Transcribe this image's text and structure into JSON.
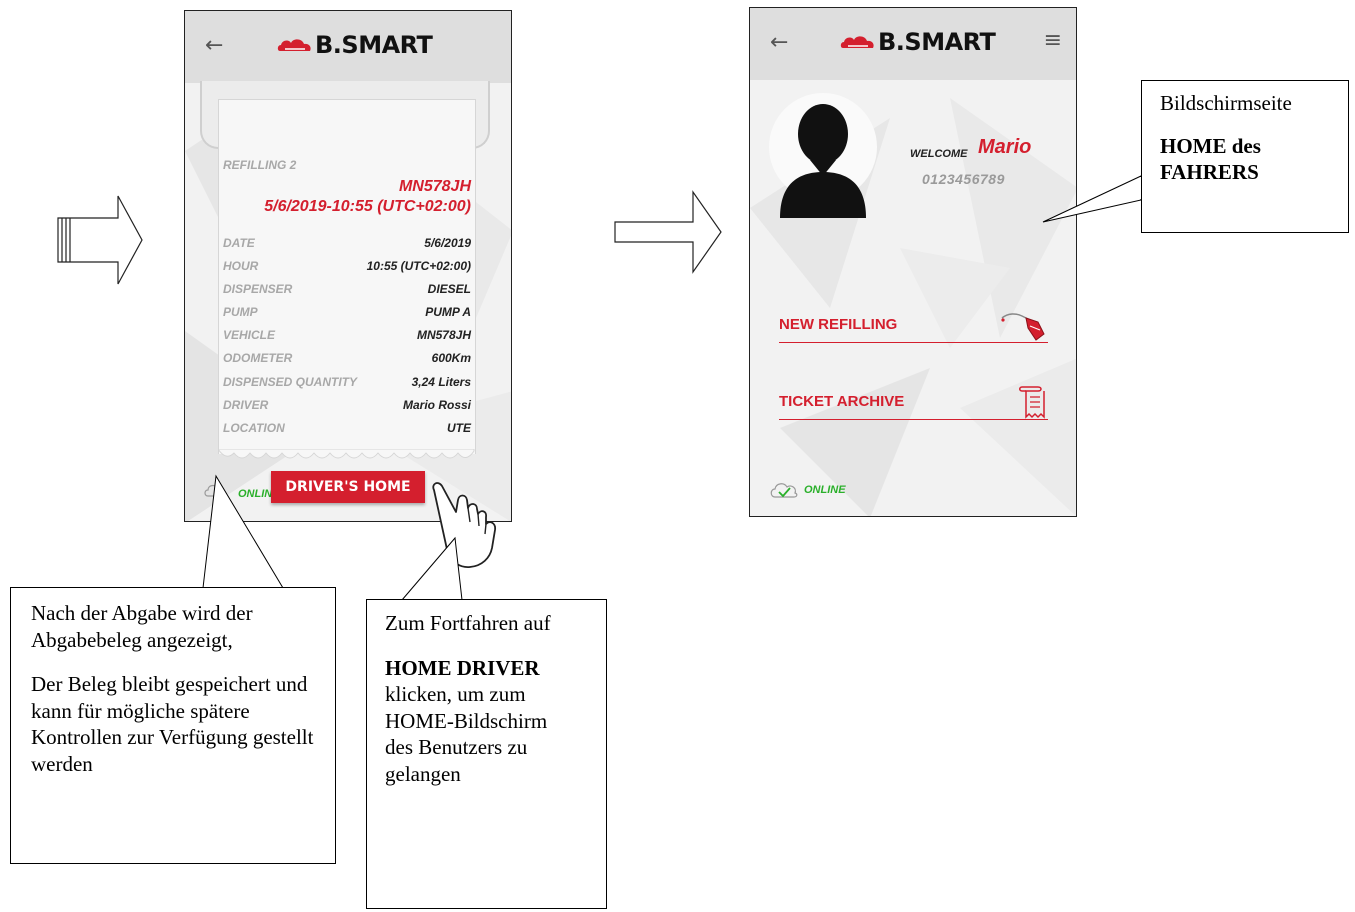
{
  "brand": {
    "logo_text": "B.SMART",
    "accent": "#d41f2e",
    "online_color": "#2bb02b"
  },
  "receipt_screen": {
    "header": {
      "back_icon": "back-arrow-icon",
      "logo": "B.SMART"
    },
    "receipt": {
      "title": "REFILLING 2",
      "plate": "MN578JH",
      "datetime": "5/6/2019-10:55 (UTC+02:00)",
      "rows": [
        {
          "label": "DATE",
          "value": "5/6/2019"
        },
        {
          "label": "HOUR",
          "value": "10:55 (UTC+02:00)"
        },
        {
          "label": "DISPENSER",
          "value": "DIESEL"
        },
        {
          "label": "PUMP",
          "value": "PUMP A"
        },
        {
          "label": "VEHICLE",
          "value": "MN578JH"
        },
        {
          "label": "ODOMETER",
          "value": "600Km"
        },
        {
          "label": "DISPENSED QUANTITY",
          "value": "3,24 Liters"
        },
        {
          "label": "DRIVER",
          "value": "Mario Rossi"
        },
        {
          "label": "LOCATION",
          "value": "UTE"
        }
      ]
    },
    "status": "ONLINE",
    "drivers_home_button": "DRIVER'S HOME"
  },
  "home_screen": {
    "header": {
      "back_icon": "back-arrow-icon",
      "logo": "B.SMART",
      "menu_icon": "hamburger-menu-icon"
    },
    "welcome_label": "WELCOME",
    "user_name": "Mario",
    "user_phone": "0123456789",
    "menu": [
      {
        "label": "NEW REFILLING",
        "icon": "fuel-nozzle-icon"
      },
      {
        "label": "TICKET ARCHIVE",
        "icon": "receipt-icon"
      }
    ],
    "status": "ONLINE"
  },
  "callouts": {
    "home_screen": {
      "line1": "Bildschirmseite",
      "line2": "HOME des FAHRERS"
    },
    "receipt": {
      "para1": "Nach der Abgabe wird der Abgabebeleg angezeigt,",
      "para2": "Der Beleg bleibt gespeichert und kann für mögliche spätere Kontrollen zur Verfügung gestellt werden"
    },
    "continue": {
      "para1": "Zum Fortfahren auf",
      "bold": "HOME DRIVER",
      "para2": "klicken, um zum HOME-Bildschirm des Benutzers zu gelangen"
    }
  }
}
